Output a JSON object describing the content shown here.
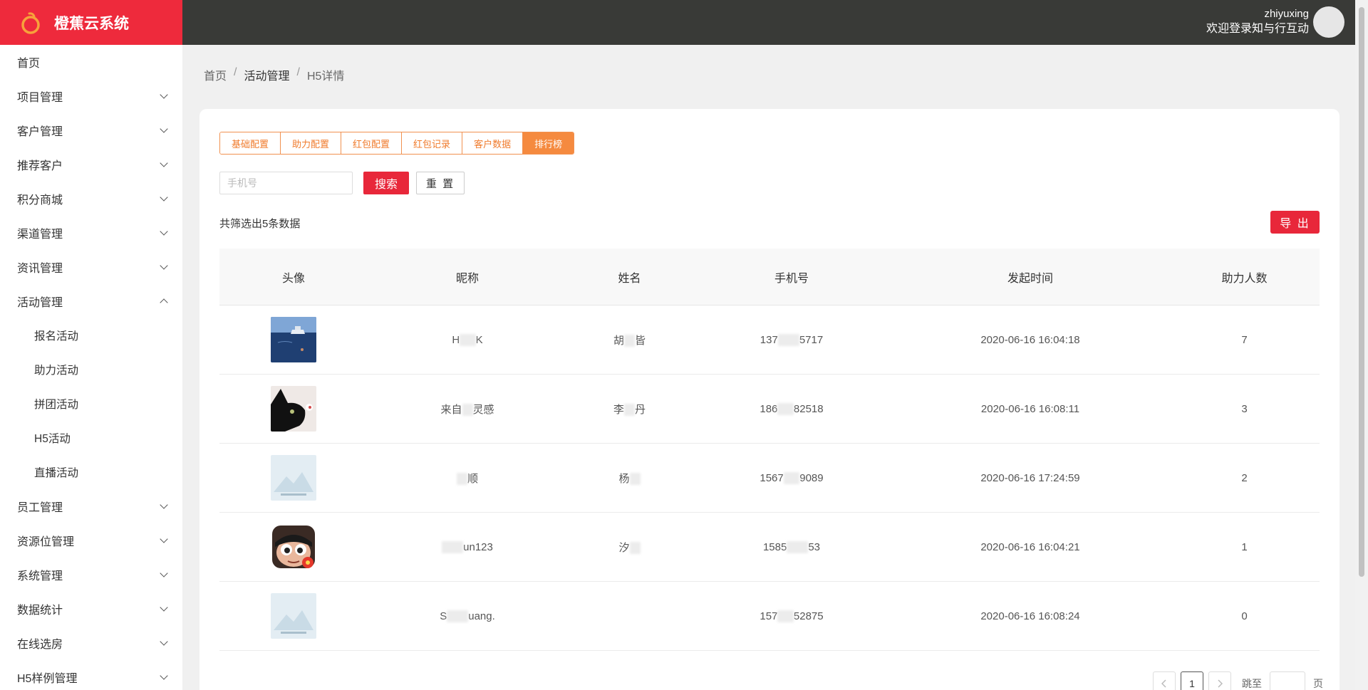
{
  "app": {
    "title": "橙蕉云系统"
  },
  "user": {
    "name": "zhiyuxing",
    "welcome": "欢迎登录知与行互动"
  },
  "sidebar": {
    "items": [
      {
        "label": "首页",
        "expandable": false
      },
      {
        "label": "项目管理",
        "expandable": true
      },
      {
        "label": "客户管理",
        "expandable": true
      },
      {
        "label": "推荐客户",
        "expandable": true
      },
      {
        "label": "积分商城",
        "expandable": true
      },
      {
        "label": "渠道管理",
        "expandable": true
      },
      {
        "label": "资讯管理",
        "expandable": true
      },
      {
        "label": "活动管理",
        "expandable": true,
        "expanded": true
      }
    ],
    "sub_items": [
      "报名活动",
      "助力活动",
      "拼团活动",
      "H5活动",
      "直播活动"
    ],
    "items_after": [
      "员工管理",
      "资源位管理",
      "系统管理",
      "数据统计",
      "在线选房",
      "H5样例管理"
    ]
  },
  "breadcrumb": {
    "home": "首页",
    "section": "活动管理",
    "current": "H5详情",
    "separator": "/"
  },
  "tabs": [
    "基础配置",
    "助力配置",
    "红包配置",
    "红包记录",
    "客户数据",
    "排行榜"
  ],
  "active_tab": "排行榜",
  "search": {
    "placeholder": "手机号",
    "value": "",
    "search_label": "搜索",
    "reset_label": "重 置"
  },
  "summary": {
    "count_text": "共筛选出5条数据"
  },
  "export_label": "导 出",
  "table": {
    "headers": [
      "头像",
      "昵称",
      "姓名",
      "手机号",
      "发起时间",
      "助力人数"
    ],
    "rows": [
      {
        "avatar": "ocean-boat-photo",
        "nick_a": "H",
        "nick_b": "K",
        "name_a": "胡",
        "name_b": "皆",
        "phone_a": "137",
        "phone_b": "5717",
        "time": "2020-06-16 16:04:18",
        "count": "7"
      },
      {
        "avatar": "black-cat-photo",
        "nick_a": "来自",
        "nick_b": "灵感",
        "name_a": "李",
        "name_b": "丹",
        "phone_a": "186",
        "phone_b": "82518",
        "time": "2020-06-16 16:08:11",
        "count": "3"
      },
      {
        "avatar": "placeholder-image",
        "nick_a": "",
        "nick_b": "顺",
        "name_a": "杨",
        "name_b": "",
        "phone_a": "1567",
        "phone_b": "9089",
        "time": "2020-06-16 17:24:59",
        "count": "2"
      },
      {
        "avatar": "cartoon-face",
        "nick_a": "",
        "nick_b": "un123",
        "name_a": "汐",
        "name_b": "",
        "phone_a": "1585",
        "phone_b": "53",
        "time": "2020-06-16 16:04:21",
        "count": "1"
      },
      {
        "avatar": "placeholder-image",
        "nick_a": "S",
        "nick_b": "uang.",
        "name_a": "",
        "name_b": "",
        "phone_a": "157",
        "phone_b": "52875",
        "time": "2020-06-16 16:08:24",
        "count": "0"
      }
    ]
  },
  "pagination": {
    "current_page": "1",
    "goto_label": "跳至",
    "page_unit": "页"
  },
  "colors": {
    "brand": "#ee2a3c",
    "accent_orange": "#f58a3f",
    "topbar": "#393a37"
  }
}
